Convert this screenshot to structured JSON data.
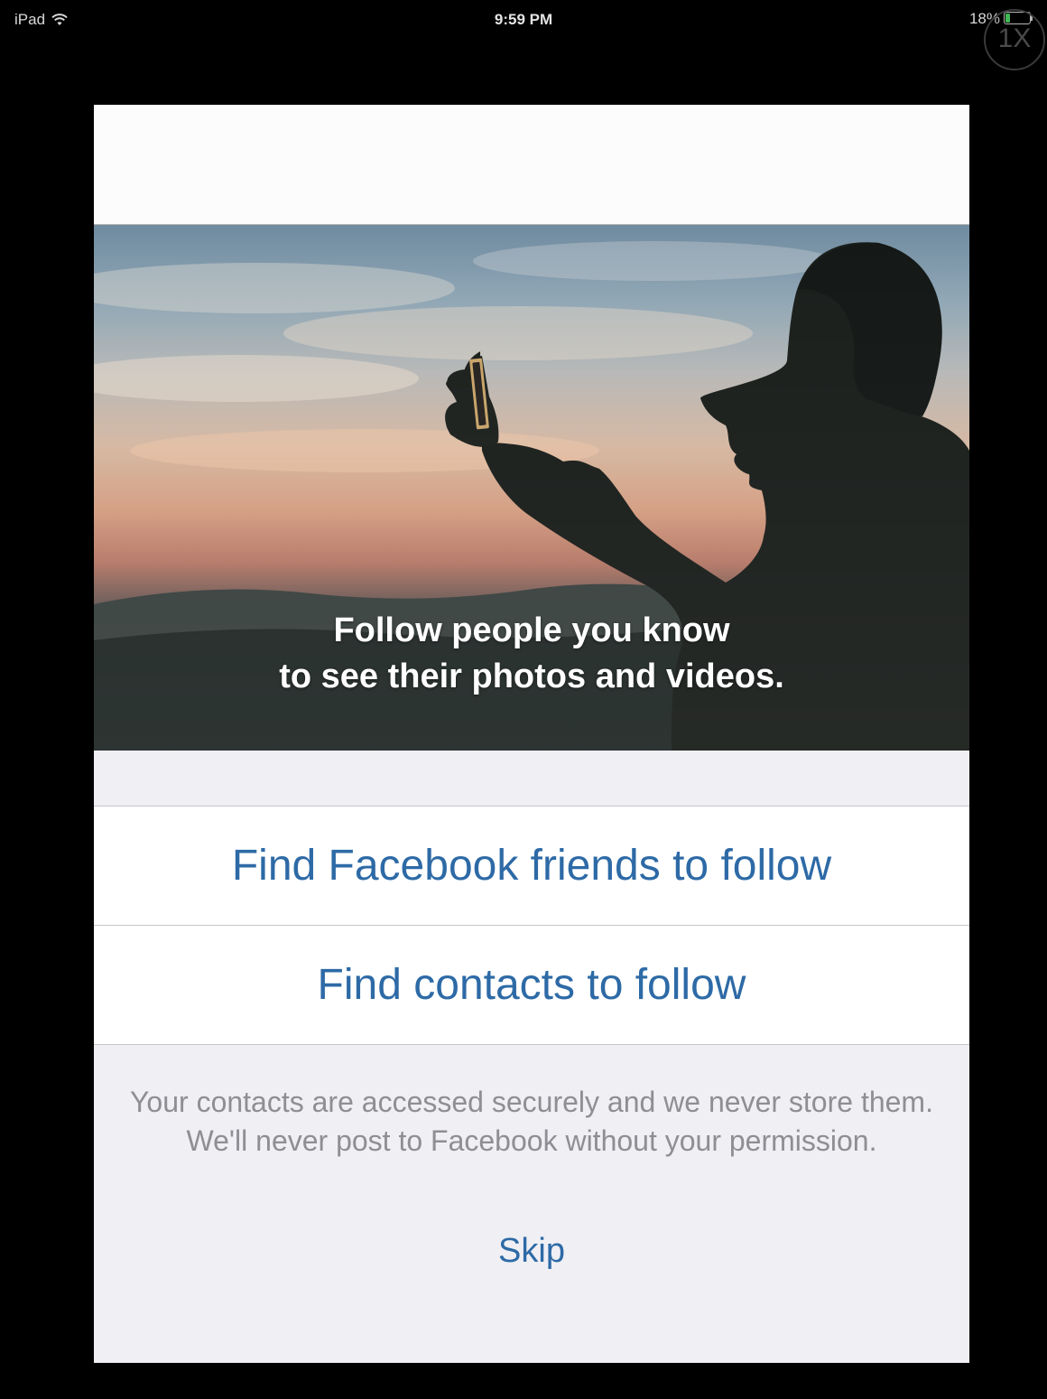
{
  "status_bar": {
    "device": "iPad",
    "time": "9:59 PM",
    "battery_percent": "18%",
    "battery_level": 0.18,
    "zoom_label": "1X",
    "icons": [
      "wifi-icon",
      "battery-icon"
    ]
  },
  "hero": {
    "caption_line1": "Follow people you know",
    "caption_line2": "to see their photos and videos."
  },
  "actions": {
    "facebook_label": "Find Facebook friends to follow",
    "contacts_label": "Find contacts to follow"
  },
  "privacy_note": "Your contacts are accessed securely and we never store them. We'll never post to Facebook without your permission.",
  "skip_label": "Skip",
  "colors": {
    "link_blue": "#2d6aa6",
    "note_gray": "#8e8e93",
    "background": "#efeff4"
  }
}
